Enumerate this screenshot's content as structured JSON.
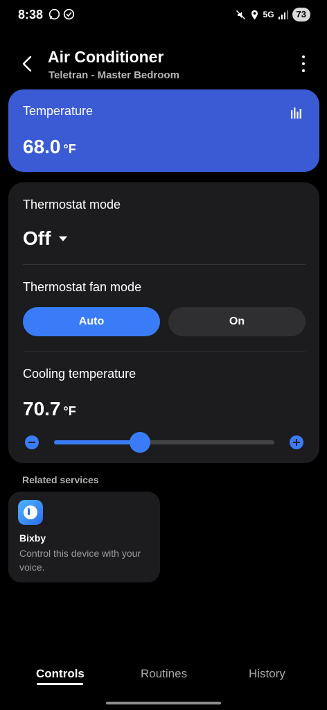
{
  "status_bar": {
    "time": "8:38",
    "network": "5G",
    "battery": "73"
  },
  "header": {
    "title": "Air Conditioner",
    "subtitle": "Teletran - Master Bedroom"
  },
  "temperature_card": {
    "label": "Temperature",
    "value": "68.0",
    "unit": "°F",
    "color": "#3a5bd4"
  },
  "thermostat": {
    "mode_label": "Thermostat mode",
    "mode_value": "Off",
    "fan_mode_label": "Thermostat fan mode",
    "fan_options": [
      "Auto",
      "On"
    ],
    "fan_selected": "Auto",
    "cooling_label": "Cooling temperature",
    "cooling_value": "70.7",
    "cooling_unit": "°F",
    "cooling_slider_fraction": 0.39
  },
  "related": {
    "label": "Related services",
    "service_name": "Bixby",
    "service_desc": "Control this device with your voice."
  },
  "nav": {
    "tabs": [
      "Controls",
      "Routines",
      "History"
    ],
    "active": "Controls"
  },
  "colors": {
    "accent": "#3a7cf7",
    "card_bg": "#1c1c1e"
  }
}
